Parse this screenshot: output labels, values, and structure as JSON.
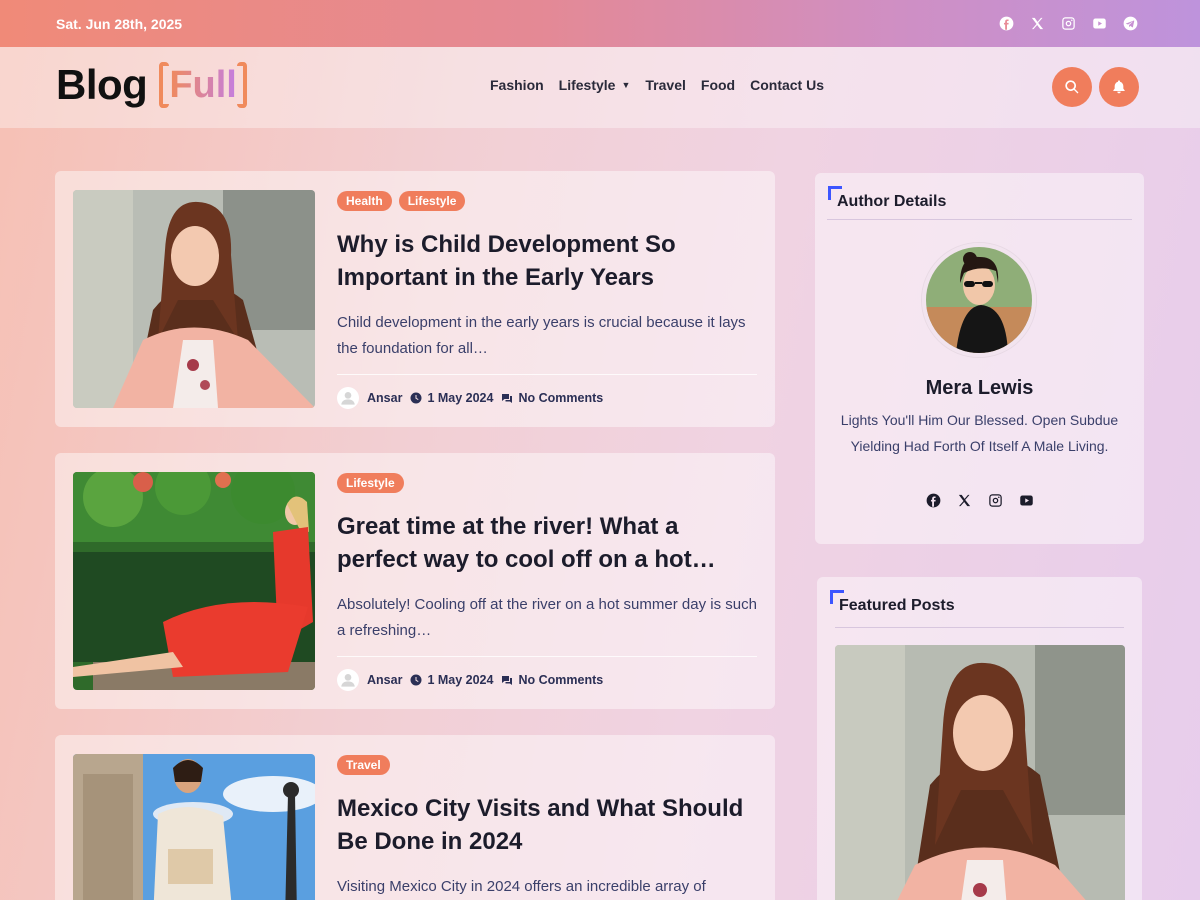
{
  "topbar": {
    "date": "Sat. Jun 28th, 2025",
    "socials": [
      "facebook-icon",
      "x-icon",
      "instagram-icon",
      "youtube-icon",
      "telegram-icon"
    ]
  },
  "header": {
    "logo_main": "Blog",
    "logo_sub": "Full",
    "nav": [
      "Fashion",
      "Lifestyle",
      "Travel",
      "Food",
      "Contact Us"
    ],
    "accent_color": "#f07d5c"
  },
  "posts": [
    {
      "tags": [
        "Health",
        "Lifestyle"
      ],
      "title": "Why is Child Development So Important in the Early Years",
      "excerpt": "Child development in the early years is crucial because it lays the foundation for all…",
      "author": "Ansar",
      "date": "1 May 2024",
      "comments": "No Comments"
    },
    {
      "tags": [
        "Lifestyle"
      ],
      "title": "Great time at the river! What a perfect way to cool off on a hot…",
      "excerpt": "Absolutely! Cooling off at the river on a hot summer day is such a refreshing…",
      "author": "Ansar",
      "date": "1 May 2024",
      "comments": "No Comments"
    },
    {
      "tags": [
        "Travel"
      ],
      "title": "Mexico City Visits and What Should Be Done in 2024",
      "excerpt": "Visiting Mexico City in 2024 offers an incredible array of"
    }
  ],
  "sidebar": {
    "author_widget": {
      "title": "Author Details",
      "name": "Mera Lewis",
      "bio": "Lights You'll Him Our Blessed. Open Subdue Yielding Had Forth Of Itself A Male Living.",
      "socials": [
        "facebook-icon",
        "x-icon",
        "instagram-icon",
        "youtube-icon"
      ]
    },
    "featured_widget": {
      "title": "Featured Posts"
    }
  }
}
